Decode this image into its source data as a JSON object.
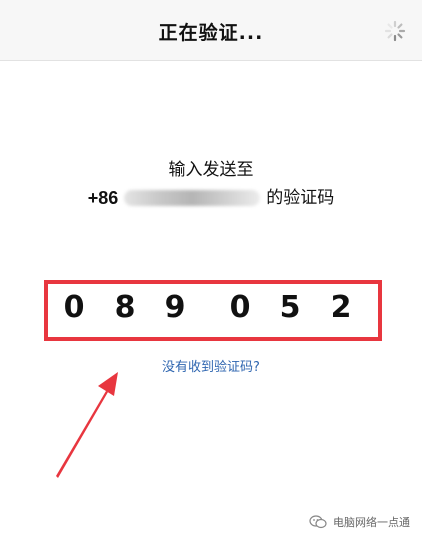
{
  "header": {
    "title": "正在验证...",
    "spinner_icon": "loading-spinner-icon"
  },
  "prompt": {
    "line1": "输入发送至",
    "phone_prefix": "+86",
    "line2_suffix": "的验证码"
  },
  "code": {
    "digits": [
      "0",
      "8",
      "9",
      "0",
      "5",
      "2"
    ],
    "highlight_color": "#e8363f"
  },
  "links": {
    "not_received": "没有收到验证码?"
  },
  "watermark": {
    "text": "电脑网络一点通",
    "icon": "wechat-icon"
  },
  "colors": {
    "link": "#2f66b0",
    "annotation": "#e8363f"
  }
}
